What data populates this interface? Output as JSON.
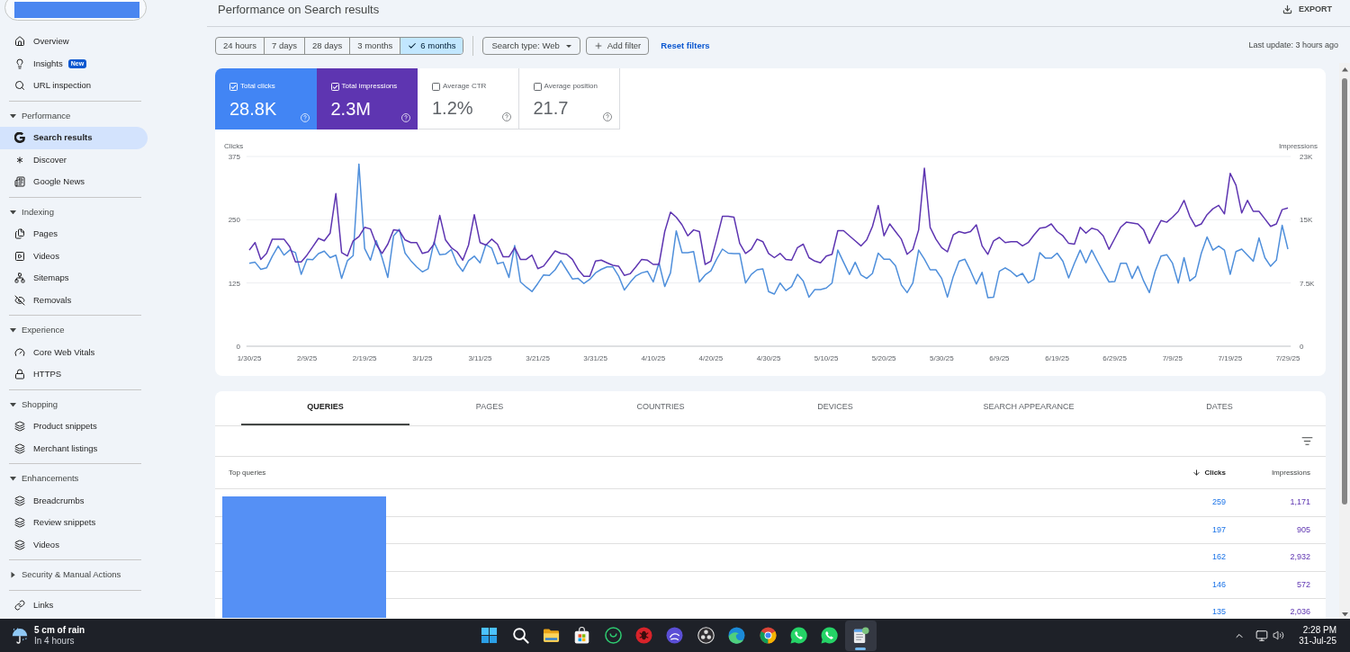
{
  "sidebar": {
    "property": {
      "redacted": true
    },
    "groups": [
      {
        "items": [
          {
            "label": "Overview",
            "selected": false
          },
          {
            "label": "Insights",
            "badge": "New",
            "selected": false
          },
          {
            "label": "URL inspection",
            "selected": false
          }
        ]
      },
      {
        "title": "Performance",
        "expanded": true,
        "items": [
          {
            "label": "Search results",
            "selected": true
          },
          {
            "label": "Discover",
            "selected": false
          },
          {
            "label": "Google News",
            "selected": false
          }
        ]
      },
      {
        "title": "Indexing",
        "expanded": true,
        "items": [
          {
            "label": "Pages",
            "selected": false
          },
          {
            "label": "Videos",
            "selected": false
          },
          {
            "label": "Sitemaps",
            "selected": false
          },
          {
            "label": "Removals",
            "selected": false
          }
        ]
      },
      {
        "title": "Experience",
        "expanded": true,
        "items": [
          {
            "label": "Core Web Vitals",
            "selected": false
          },
          {
            "label": "HTTPS",
            "selected": false
          }
        ]
      },
      {
        "title": "Shopping",
        "expanded": true,
        "items": [
          {
            "label": "Product snippets",
            "selected": false
          },
          {
            "label": "Merchant listings",
            "selected": false
          }
        ]
      },
      {
        "title": "Enhancements",
        "expanded": true,
        "items": [
          {
            "label": "Breadcrumbs",
            "selected": false
          },
          {
            "label": "Review snippets",
            "selected": false
          },
          {
            "label": "Videos",
            "selected": false
          }
        ]
      },
      {
        "title": "Security & Manual Actions",
        "expanded": false
      },
      {
        "items": [
          {
            "label": "Links",
            "selected": false
          }
        ]
      }
    ]
  },
  "header": {
    "title": "Performance on Search results",
    "export": "EXPORT"
  },
  "filters": {
    "date_ranges": [
      {
        "label": "24 hours",
        "selected": false
      },
      {
        "label": "7 days",
        "selected": false
      },
      {
        "label": "28 days",
        "selected": false
      },
      {
        "label": "3 months",
        "selected": false
      },
      {
        "label": "6 months",
        "selected": true
      }
    ],
    "search_type": "Search type: Web",
    "add_filter": "Add filter",
    "reset": "Reset filters",
    "last_update": "Last update: 3 hours ago"
  },
  "metrics": [
    {
      "label": "Total clicks",
      "value": "28.8K",
      "checked": true,
      "color": "#4285f4"
    },
    {
      "label": "Total impressions",
      "value": "2.3M",
      "checked": true,
      "color": "#5e35b1"
    },
    {
      "label": "Average CTR",
      "value": "1.2%",
      "checked": false
    },
    {
      "label": "Average position",
      "value": "21.7",
      "checked": false
    }
  ],
  "chart": {
    "chart_data": {
      "type": "line",
      "ylabel": "Clicks",
      "y2label": "Impressions",
      "categories": [
        "1/30/25",
        null,
        null,
        null,
        null,
        null,
        null,
        null,
        null,
        null,
        "2/9/25",
        null,
        null,
        null,
        null,
        null,
        null,
        null,
        null,
        null,
        "2/19/25",
        null,
        null,
        null,
        null,
        null,
        null,
        null,
        null,
        null,
        "3/1/25",
        null,
        null,
        null,
        null,
        null,
        null,
        null,
        null,
        null,
        "3/11/25",
        null,
        null,
        null,
        null,
        null,
        null,
        null,
        null,
        null,
        "3/21/25",
        null,
        null,
        null,
        null,
        null,
        null,
        null,
        null,
        null,
        "3/31/25",
        null,
        null,
        null,
        null,
        null,
        null,
        null,
        null,
        null,
        "4/10/25",
        null,
        null,
        null,
        null,
        null,
        null,
        null,
        null,
        null,
        "4/20/25",
        null,
        null,
        null,
        null,
        null,
        null,
        null,
        null,
        null,
        "4/30/25",
        null,
        null,
        null,
        null,
        null,
        null,
        null,
        null,
        null,
        "5/10/25",
        null,
        null,
        null,
        null,
        null,
        null,
        null,
        null,
        null,
        "5/20/25",
        null,
        null,
        null,
        null,
        null,
        null,
        null,
        null,
        null,
        "5/30/25",
        null,
        null,
        null,
        null,
        null,
        null,
        null,
        null,
        null,
        "6/9/25",
        null,
        null,
        null,
        null,
        null,
        null,
        null,
        null,
        null,
        "6/19/25",
        null,
        null,
        null,
        null,
        null,
        null,
        null,
        null,
        null,
        "6/29/25",
        null,
        null,
        null,
        null,
        null,
        null,
        null,
        null,
        null,
        "7/9/25",
        null,
        null,
        null,
        null,
        null,
        null,
        null,
        null,
        null,
        "7/19/25",
        null,
        null,
        null,
        null,
        null,
        null,
        null,
        null,
        null,
        "7/29/25"
      ],
      "ylim": [
        0,
        375
      ],
      "yticks": [
        0,
        125,
        250,
        375
      ],
      "y2lim": [
        0,
        22500
      ],
      "y2ticks": [
        {
          "value": 0,
          "label": "0"
        },
        {
          "value": 7500,
          "label": "7.5K"
        },
        {
          "value": 15000,
          "label": "15K"
        },
        {
          "value": 22500,
          "label": "23K"
        }
      ],
      "series": [
        {
          "color": "#4f8fdb",
          "values": [
            164,
            166,
            152,
            155,
            178,
            198,
            180,
            190,
            185,
            142,
            172,
            171,
            183,
            188,
            175,
            180,
            134,
            169,
            179,
            360,
            193,
            170,
            209,
            175,
            136,
            218,
            231,
            184,
            169,
            157,
            147,
            153,
            206,
            181,
            182,
            191,
            163,
            148,
            169,
            178,
            165,
            201,
            194,
            163,
            166,
            136,
            199,
            127,
            117,
            108,
            124,
            141,
            140,
            151,
            169,
            151,
            133,
            134,
            124,
            132,
            145,
            152,
            157,
            157,
            139,
            111,
            126,
            139,
            145,
            148,
            127,
            165,
            118,
            145,
            228,
            185,
            185,
            187,
            127,
            141,
            149,
            172,
            192,
            184,
            183,
            183,
            125,
            142,
            151,
            153,
            108,
            103,
            125,
            110,
            118,
            142,
            129,
            97,
            112,
            112,
            115,
            125,
            190,
            166,
            142,
            166,
            141,
            134,
            144,
            184,
            172,
            172,
            159,
            121,
            106,
            125,
            190,
            172,
            151,
            151,
            134,
            97,
            138,
            168,
            172,
            149,
            123,
            146,
            96,
            97,
            148,
            155,
            148,
            138,
            144,
            125,
            132,
            185,
            174,
            174,
            184,
            168,
            135,
            164,
            190,
            165,
            190,
            168,
            147,
            127,
            128,
            164,
            164,
            134,
            158,
            129,
            106,
            148,
            178,
            181,
            164,
            125,
            175,
            129,
            138,
            184,
            216,
            190,
            198,
            190,
            142,
            187,
            192,
            180,
            168,
            214,
            175,
            158,
            170,
            239,
            192
          ]
        },
        {
          "axis": "y2",
          "color": "#5e35b1",
          "values": [
            11400,
            12300,
            10300,
            11000,
            12700,
            12700,
            12700,
            11800,
            10000,
            10000,
            10800,
            11800,
            12800,
            12500,
            13400,
            18100,
            11100,
            10700,
            12500,
            13000,
            14100,
            13900,
            12100,
            11000,
            12100,
            13800,
            13700,
            12600,
            12300,
            12300,
            11000,
            11200,
            12100,
            15500,
            12600,
            11700,
            11200,
            10200,
            12000,
            15600,
            12300,
            12000,
            12700,
            12100,
            10600,
            10600,
            11700,
            10300,
            10300,
            10800,
            9200,
            9500,
            10400,
            11300,
            11000,
            10900,
            10300,
            9100,
            8300,
            8300,
            10100,
            10200,
            9900,
            9600,
            9500,
            8400,
            8600,
            9400,
            10300,
            10200,
            9700,
            9700,
            13600,
            15900,
            15300,
            14400,
            13100,
            13800,
            13600,
            9700,
            10100,
            12700,
            15400,
            15400,
            15300,
            12200,
            11000,
            11500,
            12700,
            12400,
            11000,
            10500,
            11000,
            10300,
            10200,
            11700,
            12100,
            10500,
            10100,
            9900,
            10700,
            10900,
            13700,
            13700,
            13100,
            12500,
            11900,
            12600,
            14200,
            16700,
            13100,
            14500,
            13600,
            12700,
            10900,
            11500,
            13800,
            21100,
            14100,
            12700,
            11700,
            11200,
            13200,
            13600,
            13400,
            13600,
            14400,
            11900,
            10900,
            12500,
            12900,
            12300,
            12400,
            12400,
            11900,
            12300,
            13200,
            14000,
            14100,
            14500,
            13600,
            13100,
            12200,
            12100,
            14100,
            13400,
            14000,
            13800,
            13100,
            11500,
            12800,
            14100,
            14700,
            14600,
            14500,
            13800,
            12200,
            13600,
            14900,
            14700,
            15300,
            16000,
            17300,
            15400,
            14200,
            14500,
            15600,
            16300,
            16700,
            15700,
            20500,
            19100,
            15800,
            17300,
            16000,
            16000,
            15100,
            14200,
            14500,
            16200,
            16400
          ]
        }
      ]
    }
  },
  "table": {
    "tabs": [
      {
        "label": "QUERIES",
        "selected": true
      },
      {
        "label": "PAGES",
        "selected": false
      },
      {
        "label": "COUNTRIES",
        "selected": false
      },
      {
        "label": "DEVICES",
        "selected": false
      },
      {
        "label": "SEARCH APPEARANCE",
        "selected": false
      },
      {
        "label": "DATES",
        "selected": false
      }
    ],
    "columns": [
      {
        "label": "Top queries",
        "sorted": false
      },
      {
        "label": "Clicks",
        "sorted": true
      },
      {
        "label": "Impressions",
        "sorted": false
      }
    ],
    "queries_redacted": true,
    "rows": [
      {
        "clicks": "259",
        "impressions": "1,171"
      },
      {
        "clicks": "197",
        "impressions": "905"
      },
      {
        "clicks": "162",
        "impressions": "2,932"
      },
      {
        "clicks": "146",
        "impressions": "572"
      },
      {
        "clicks": "135",
        "impressions": "2,036"
      }
    ]
  },
  "taskbar": {
    "weather": {
      "summary": "5 cm of rain",
      "time": "In 4 hours"
    },
    "apps": [
      {
        "active": false
      },
      {
        "active": false
      },
      {
        "active": false
      },
      {
        "active": false
      },
      {
        "active": false
      },
      {
        "active": false
      },
      {
        "active": false
      },
      {
        "active": false
      },
      {
        "active": false
      },
      {
        "active": false
      },
      {
        "active": false
      },
      {
        "active": false
      },
      {
        "active": true
      }
    ],
    "clock": {
      "time": "2:28 PM",
      "date": "31-Jul-25"
    }
  }
}
